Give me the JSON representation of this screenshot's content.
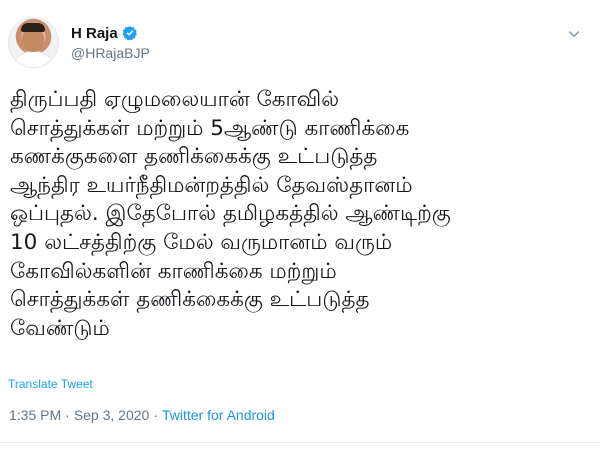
{
  "user": {
    "display_name": "H Raja",
    "handle": "@HRajaBJP",
    "verified": true
  },
  "icons": {
    "verified": "verified-badge-icon",
    "more": "chevron-down-icon"
  },
  "tweet": {
    "text": "திருப்பதி ஏழுமலையான் கோவில்\nசொத்துக்கள் மற்றும் 5ஆண்டு காணிக்கை\nகணக்குகளை தணிக்கைக்கு உட்படுத்த\nஆந்திர உயர்நீதிமன்றத்தில் தேவஸ்தானம்\nஒப்புதல். இதேபோல் தமிழகத்தில் ஆண்டிற்கு\n10 லட்சத்திற்கு மேல் வருமானம் வரும்\nகோவில்களின் காணிக்கை மற்றும்\nசொத்துக்கள் தணிக்கைக்கு உட்படுத்த\nவேண்டும்",
    "translate_label": "Translate Tweet",
    "time": "1:35 PM",
    "separator": "·",
    "date": "Sep 3, 2020",
    "source": "Twitter for Android"
  },
  "colors": {
    "link": "#1da1f2",
    "secondary_text": "#657786",
    "verified": "#1da1f2"
  }
}
